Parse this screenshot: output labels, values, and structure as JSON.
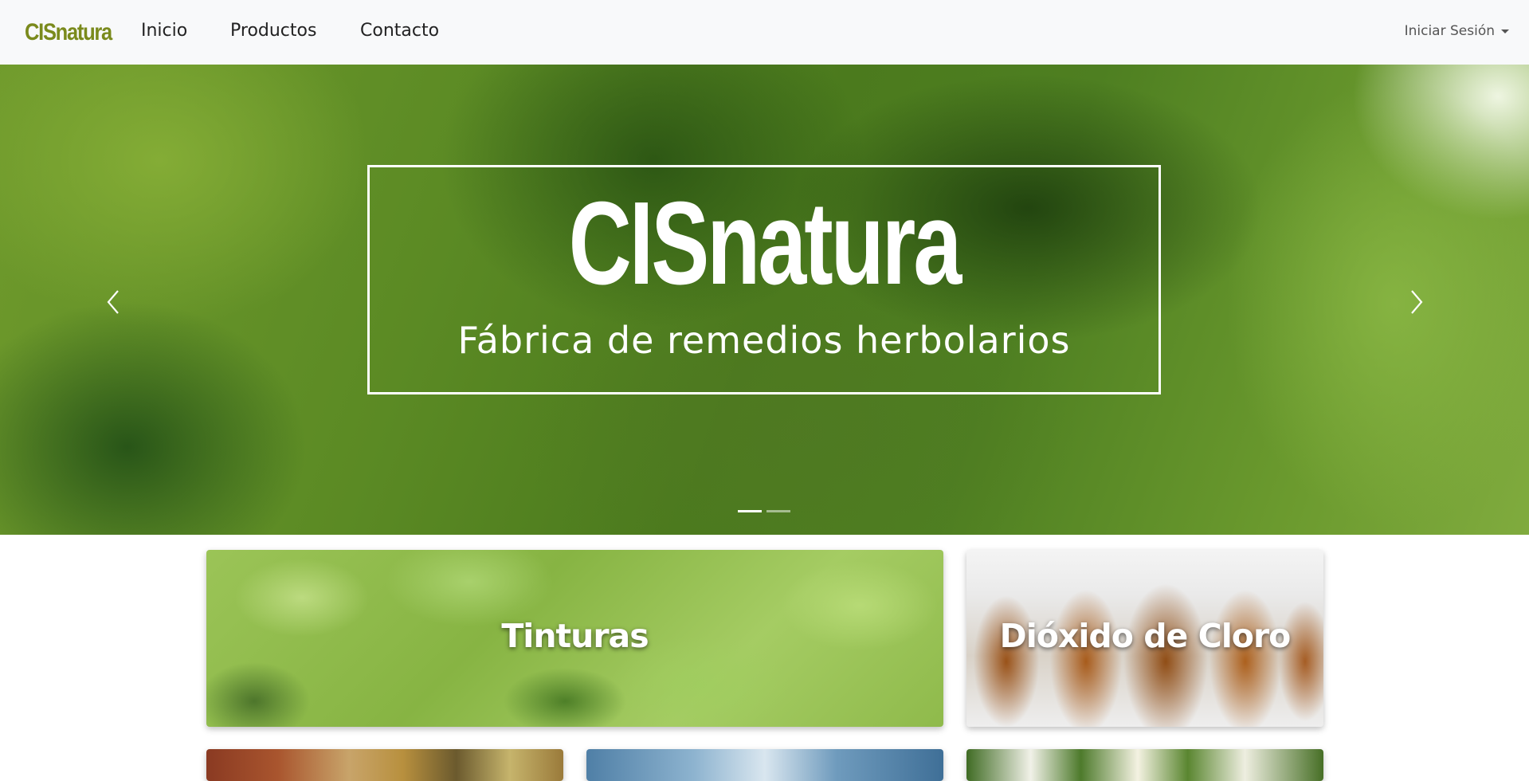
{
  "navbar": {
    "brand": "CISnatura",
    "links": [
      "Inicio",
      "Productos",
      "Contacto"
    ],
    "login_label": "Iniciar Sesión"
  },
  "hero": {
    "logo_text": "CISnatura",
    "subtitle": "Fábrica de remedios herbolarios",
    "slide_count": 2,
    "active_slide": 1
  },
  "categories": [
    {
      "title": "Tinturas"
    },
    {
      "title": "Dióxido de Cloro"
    }
  ],
  "icons": {
    "prev": "chevron-left-icon",
    "next": "chevron-right-icon",
    "dropdown": "caret-down-icon"
  },
  "colors": {
    "brand": "#7a8a1c",
    "navbar_bg": "#f8f9fa"
  }
}
